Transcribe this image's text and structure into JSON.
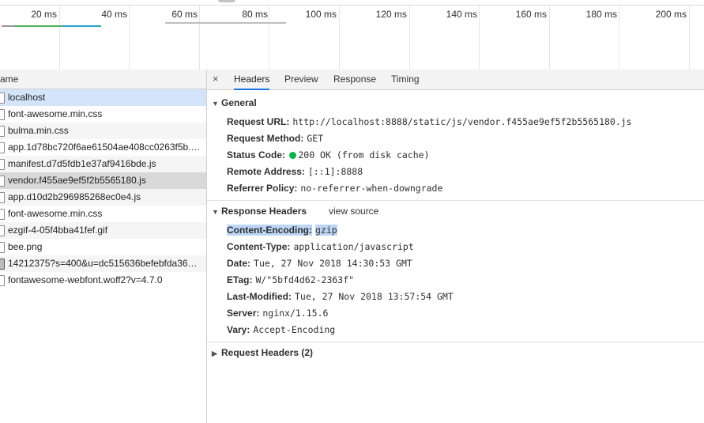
{
  "timeline": {
    "ticks": [
      "20 ms",
      "40 ms",
      "60 ms",
      "80 ms",
      "100 ms",
      "120 ms",
      "140 ms",
      "160 ms",
      "180 ms",
      "200 ms"
    ],
    "colors": {
      "bar_teal": "#2aa6c8",
      "bar_green": "#53b25d",
      "bar_grey": "#bdbdbd"
    }
  },
  "request_list": {
    "header": "ame",
    "rows": [
      {
        "name": "localhost",
        "icon": "document-icon"
      },
      {
        "name": "font-awesome.min.css",
        "icon": "document-icon"
      },
      {
        "name": "bulma.min.css",
        "icon": "document-icon"
      },
      {
        "name": "app.1d78bc720f6ae61504ae408cc0263f5b.…",
        "icon": "document-icon"
      },
      {
        "name": "manifest.d7d5fdb1e37af9416bde.js",
        "icon": "document-icon"
      },
      {
        "name": "vendor.f455ae9ef5f2b5565180.js",
        "icon": "document-icon"
      },
      {
        "name": "app.d10d2b296985268ec0e4.js",
        "icon": "document-icon"
      },
      {
        "name": "font-awesome.min.css",
        "icon": "document-icon"
      },
      {
        "name": "ezgif-4-05f4bba41fef.gif",
        "icon": "document-icon"
      },
      {
        "name": "bee.png",
        "icon": "document-icon"
      },
      {
        "name": "14212375?s=400&u=dc515636befebfda36…",
        "icon": "image-icon"
      },
      {
        "name": "fontawesome-webfont.woff2?v=4.7.0",
        "icon": "document-icon"
      }
    ]
  },
  "details": {
    "close": "×",
    "tabs": [
      "Headers",
      "Preview",
      "Response",
      "Timing"
    ],
    "general": {
      "title": "General",
      "rows": [
        {
          "key": "Request URL:",
          "value": "http://localhost:8888/static/js/vendor.f455ae9ef5f2b5565180.js"
        },
        {
          "key": "Request Method:",
          "value": "GET"
        },
        {
          "key": "Status Code:",
          "value": "200 OK (from disk cache)"
        },
        {
          "key": "Remote Address:",
          "value": "[::1]:8888"
        },
        {
          "key": "Referrer Policy:",
          "value": "no-referrer-when-downgrade"
        }
      ]
    },
    "response_headers": {
      "title": "Response Headers",
      "view_source": "view source",
      "rows": [
        {
          "key": "Content-Encoding:",
          "value": "gzip"
        },
        {
          "key": "Content-Type:",
          "value": "application/javascript"
        },
        {
          "key": "Date:",
          "value": "Tue, 27 Nov 2018 14:30:53 GMT"
        },
        {
          "key": "ETag:",
          "value": "W/\"5bfd4d62-2363f\""
        },
        {
          "key": "Last-Modified:",
          "value": "Tue, 27 Nov 2018 13:57:54 GMT"
        },
        {
          "key": "Server:",
          "value": "nginx/1.15.6"
        },
        {
          "key": "Vary:",
          "value": "Accept-Encoding"
        }
      ]
    },
    "request_headers": {
      "title": "Request Headers (2)"
    },
    "colors": {
      "status_ok": "#0bb34f",
      "selection": "#bcd6f5",
      "tab_underline": "#1a73e8"
    }
  }
}
